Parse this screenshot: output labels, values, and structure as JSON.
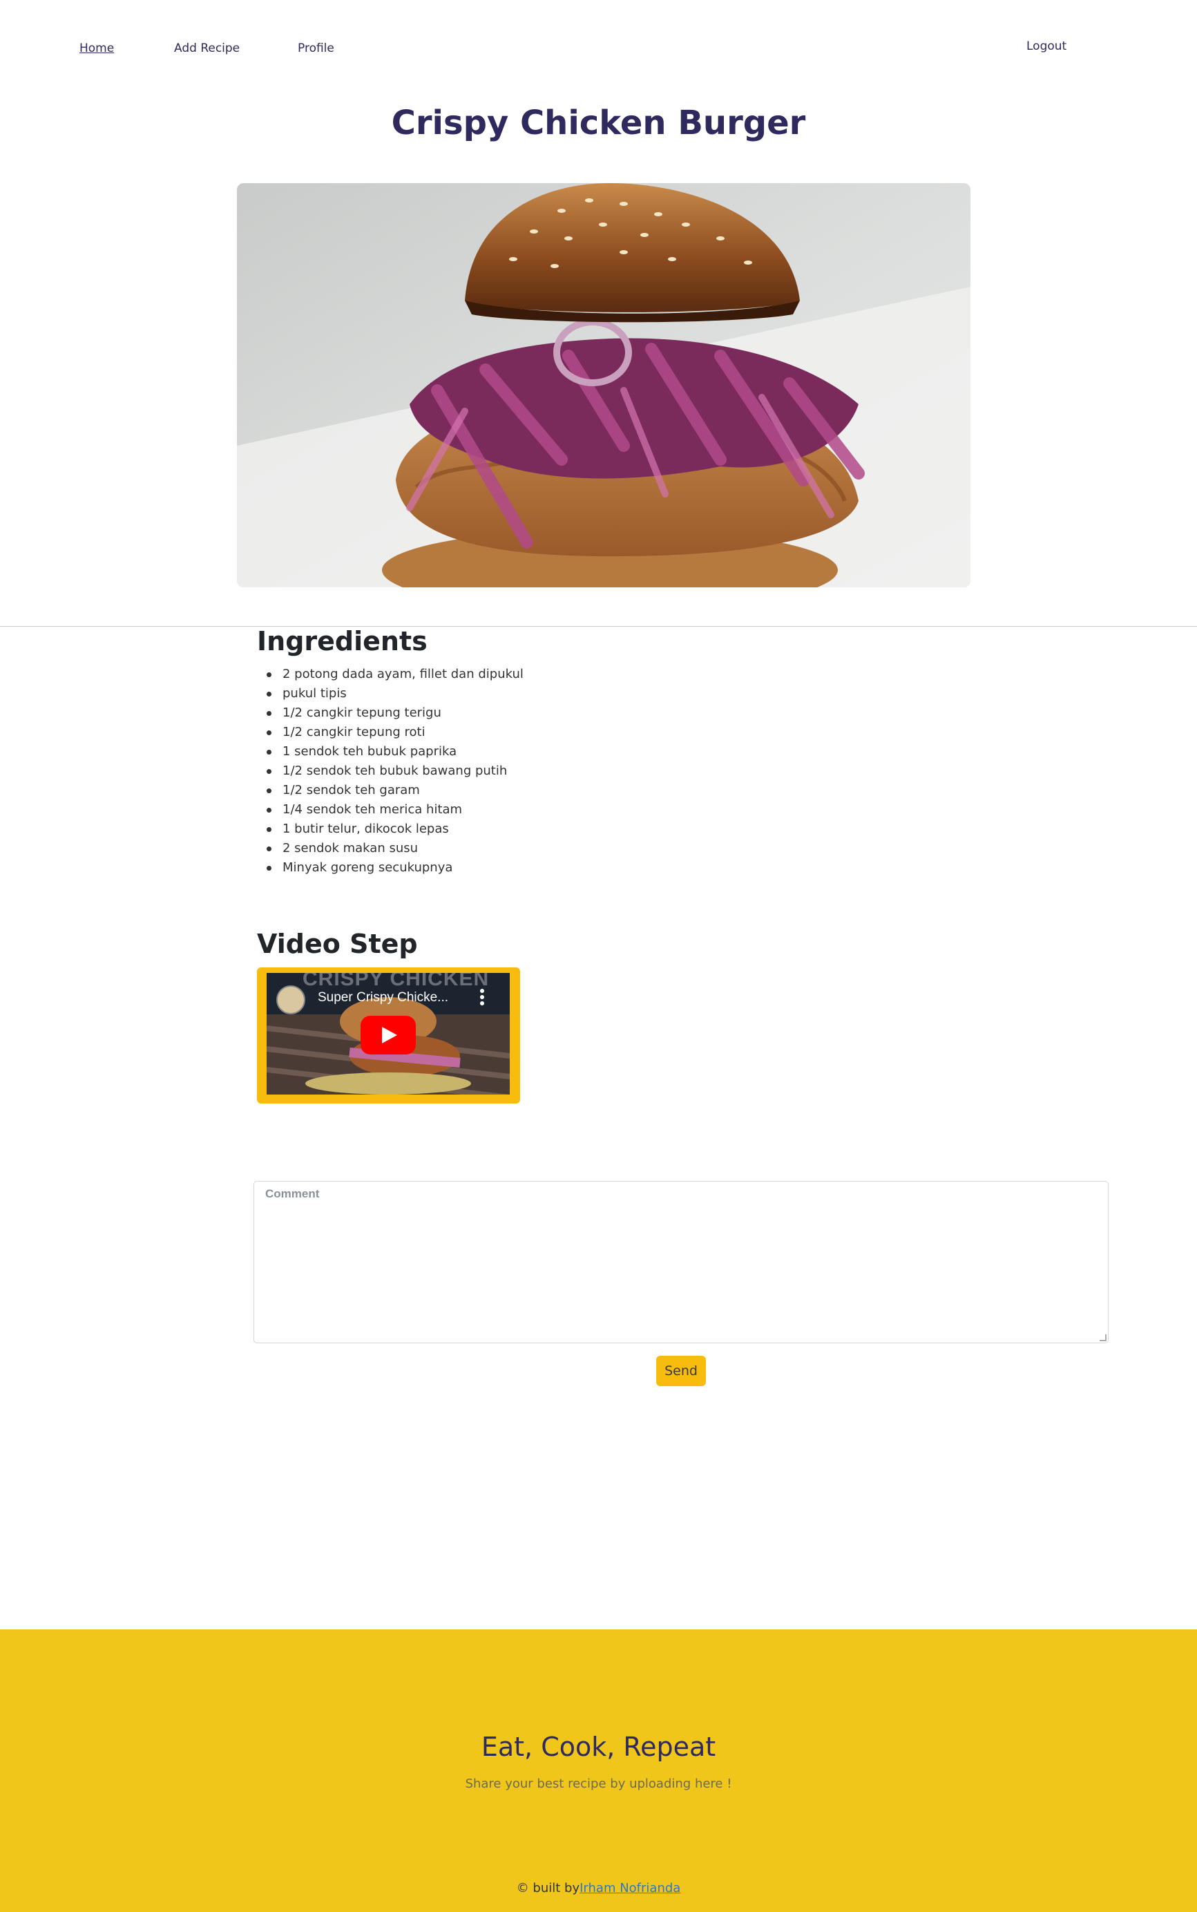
{
  "nav": {
    "home": "Home",
    "add_recipe": "Add Recipe",
    "profile": "Profile",
    "logout": "Logout"
  },
  "recipe": {
    "title": "Crispy Chicken Burger",
    "image_alt": "crispy chicken burger photo"
  },
  "ingredients": {
    "heading": "Ingredients",
    "items": [
      "2 potong dada ayam, fillet dan dipukul",
      "pukul tipis",
      "1/2 cangkir tepung terigu",
      "1/2 cangkir tepung roti",
      "1 sendok teh bubuk paprika",
      "1/2 sendok teh bubuk bawang putih",
      "1/2 sendok teh garam",
      "1/4 sendok teh merica hitam",
      "1 butir telur, dikocok lepas",
      "2 sendok makan susu",
      "Minyak goreng secukupnya"
    ]
  },
  "video": {
    "heading": "Video Step",
    "title": "Super Crispy Chicke...",
    "overlay_text": "CRISPY CHICKEN",
    "play_icon": "youtube-play-icon",
    "menu_icon": "kebab-menu-icon"
  },
  "comment": {
    "placeholder": "Comment",
    "send_label": "Send"
  },
  "footer": {
    "title": "Eat, Cook, Repeat",
    "subtitle": "Share your best recipe by uploading here !",
    "credit_prefix": "© built by",
    "credit_name": "Irham Nofrianda"
  },
  "colors": {
    "brand_dark": "#2e2a5e",
    "accent_yellow": "#f8bc0e",
    "footer_yellow": "#f0c61b",
    "link_blue": "#2f78c2"
  }
}
